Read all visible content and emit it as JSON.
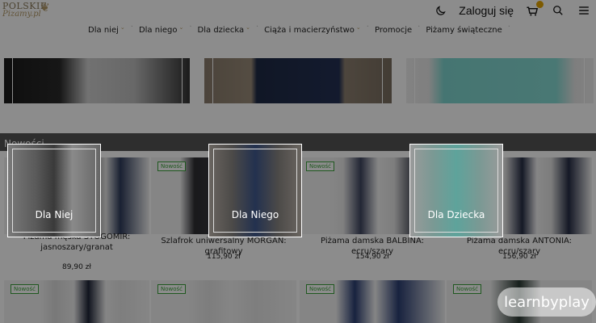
{
  "header": {
    "logo_line1": "POLSKIE",
    "logo_line2": "Pizamy.pl",
    "login_label": "Zaloguj się"
  },
  "nav": {
    "items": [
      {
        "label": "Dla niej",
        "has_dropdown": true
      },
      {
        "label": "Dla niego",
        "has_dropdown": true
      },
      {
        "label": "Dla dziecka",
        "has_dropdown": true
      },
      {
        "label": "Ciąża i macierzyństwo",
        "has_dropdown": true
      },
      {
        "label": "Promocje",
        "has_dropdown": false
      },
      {
        "label": "Piżamy świąteczne",
        "has_dropdown": false
      }
    ]
  },
  "section": {
    "title": "Nowości"
  },
  "badge_new": "Nowość",
  "categories": [
    {
      "label": "Dla Niej"
    },
    {
      "label": "Dla Niego"
    },
    {
      "label": "Dla Dziecka"
    }
  ],
  "products": [
    {
      "name": "Piżama męska STOGOMIR: jasnoszary/granat",
      "price": "89,90 zł"
    },
    {
      "name": "Szlafrok uniwersalny MORGAN: grafitowy",
      "price": "115,90 zł"
    },
    {
      "name": "Piżama damska BALBINA: ecru/szary",
      "price": "154,90 zł"
    },
    {
      "name": "Piżama damska ANTONIA: ecru/szary",
      "price": "156,90 zł"
    }
  ],
  "watermark": "learnbyplay",
  "colors": {
    "accent_gold": "#b59b6a",
    "badge_green": "#3aa13a",
    "cart_badge": "#e3a400",
    "section_bar": "#555555"
  }
}
